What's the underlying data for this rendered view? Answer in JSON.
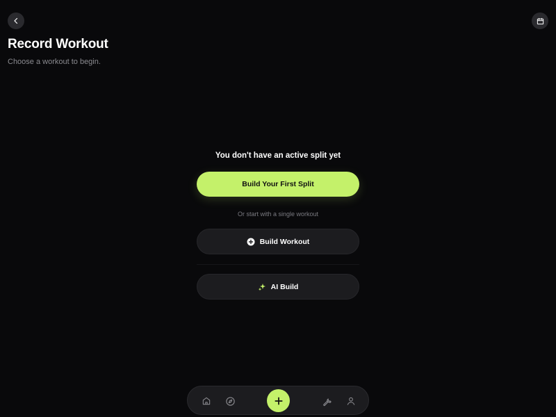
{
  "header": {
    "title": "Record Workout",
    "subtitle": "Choose a workout to begin.",
    "back_icon": "chevron-left-icon",
    "calendar_icon": "calendar-icon"
  },
  "empty_state": {
    "heading": "You don't have an active split yet",
    "primary_button_label": "Build Your First Split",
    "alt_caption": "Or start with a single workout",
    "build_workout_label": "Build Workout",
    "build_workout_icon": "plus-circle-icon",
    "ai_build_label": "AI Build",
    "ai_build_icon": "sparkle-icon"
  },
  "bottom_nav": {
    "items": [
      {
        "icon": "home-icon"
      },
      {
        "icon": "compass-icon"
      },
      {
        "icon": "plus-icon"
      },
      {
        "icon": "wrench-icon"
      },
      {
        "icon": "user-icon"
      }
    ]
  },
  "colors": {
    "background": "#09090b",
    "accent": "#c4f16a",
    "surface": "#1c1c1f",
    "muted_text": "#8b8b90"
  }
}
